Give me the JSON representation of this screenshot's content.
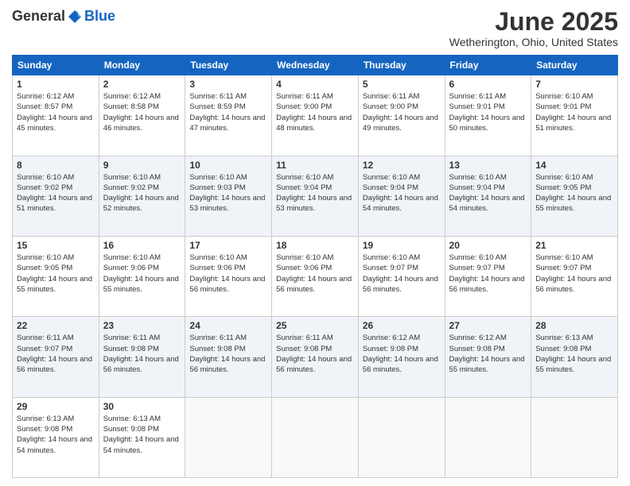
{
  "logo": {
    "general": "General",
    "blue": "Blue"
  },
  "header": {
    "month": "June 2025",
    "location": "Wetherington, Ohio, United States"
  },
  "weekdays": [
    "Sunday",
    "Monday",
    "Tuesday",
    "Wednesday",
    "Thursday",
    "Friday",
    "Saturday"
  ],
  "weeks": [
    [
      {
        "day": "1",
        "sunrise": "6:12 AM",
        "sunset": "8:57 PM",
        "daylight": "14 hours and 45 minutes."
      },
      {
        "day": "2",
        "sunrise": "6:12 AM",
        "sunset": "8:58 PM",
        "daylight": "14 hours and 46 minutes."
      },
      {
        "day": "3",
        "sunrise": "6:11 AM",
        "sunset": "8:59 PM",
        "daylight": "14 hours and 47 minutes."
      },
      {
        "day": "4",
        "sunrise": "6:11 AM",
        "sunset": "9:00 PM",
        "daylight": "14 hours and 48 minutes."
      },
      {
        "day": "5",
        "sunrise": "6:11 AM",
        "sunset": "9:00 PM",
        "daylight": "14 hours and 49 minutes."
      },
      {
        "day": "6",
        "sunrise": "6:11 AM",
        "sunset": "9:01 PM",
        "daylight": "14 hours and 50 minutes."
      },
      {
        "day": "7",
        "sunrise": "6:10 AM",
        "sunset": "9:01 PM",
        "daylight": "14 hours and 51 minutes."
      }
    ],
    [
      {
        "day": "8",
        "sunrise": "6:10 AM",
        "sunset": "9:02 PM",
        "daylight": "14 hours and 51 minutes."
      },
      {
        "day": "9",
        "sunrise": "6:10 AM",
        "sunset": "9:02 PM",
        "daylight": "14 hours and 52 minutes."
      },
      {
        "day": "10",
        "sunrise": "6:10 AM",
        "sunset": "9:03 PM",
        "daylight": "14 hours and 53 minutes."
      },
      {
        "day": "11",
        "sunrise": "6:10 AM",
        "sunset": "9:04 PM",
        "daylight": "14 hours and 53 minutes."
      },
      {
        "day": "12",
        "sunrise": "6:10 AM",
        "sunset": "9:04 PM",
        "daylight": "14 hours and 54 minutes."
      },
      {
        "day": "13",
        "sunrise": "6:10 AM",
        "sunset": "9:04 PM",
        "daylight": "14 hours and 54 minutes."
      },
      {
        "day": "14",
        "sunrise": "6:10 AM",
        "sunset": "9:05 PM",
        "daylight": "14 hours and 55 minutes."
      }
    ],
    [
      {
        "day": "15",
        "sunrise": "6:10 AM",
        "sunset": "9:05 PM",
        "daylight": "14 hours and 55 minutes."
      },
      {
        "day": "16",
        "sunrise": "6:10 AM",
        "sunset": "9:06 PM",
        "daylight": "14 hours and 55 minutes."
      },
      {
        "day": "17",
        "sunrise": "6:10 AM",
        "sunset": "9:06 PM",
        "daylight": "14 hours and 56 minutes."
      },
      {
        "day": "18",
        "sunrise": "6:10 AM",
        "sunset": "9:06 PM",
        "daylight": "14 hours and 56 minutes."
      },
      {
        "day": "19",
        "sunrise": "6:10 AM",
        "sunset": "9:07 PM",
        "daylight": "14 hours and 56 minutes."
      },
      {
        "day": "20",
        "sunrise": "6:10 AM",
        "sunset": "9:07 PM",
        "daylight": "14 hours and 56 minutes."
      },
      {
        "day": "21",
        "sunrise": "6:10 AM",
        "sunset": "9:07 PM",
        "daylight": "14 hours and 56 minutes."
      }
    ],
    [
      {
        "day": "22",
        "sunrise": "6:11 AM",
        "sunset": "9:07 PM",
        "daylight": "14 hours and 56 minutes."
      },
      {
        "day": "23",
        "sunrise": "6:11 AM",
        "sunset": "9:08 PM",
        "daylight": "14 hours and 56 minutes."
      },
      {
        "day": "24",
        "sunrise": "6:11 AM",
        "sunset": "9:08 PM",
        "daylight": "14 hours and 56 minutes."
      },
      {
        "day": "25",
        "sunrise": "6:11 AM",
        "sunset": "9:08 PM",
        "daylight": "14 hours and 56 minutes."
      },
      {
        "day": "26",
        "sunrise": "6:12 AM",
        "sunset": "9:08 PM",
        "daylight": "14 hours and 56 minutes."
      },
      {
        "day": "27",
        "sunrise": "6:12 AM",
        "sunset": "9:08 PM",
        "daylight": "14 hours and 55 minutes."
      },
      {
        "day": "28",
        "sunrise": "6:13 AM",
        "sunset": "9:08 PM",
        "daylight": "14 hours and 55 minutes."
      }
    ],
    [
      {
        "day": "29",
        "sunrise": "6:13 AM",
        "sunset": "9:08 PM",
        "daylight": "14 hours and 54 minutes."
      },
      {
        "day": "30",
        "sunrise": "6:13 AM",
        "sunset": "9:08 PM",
        "daylight": "14 hours and 54 minutes."
      },
      null,
      null,
      null,
      null,
      null
    ]
  ]
}
